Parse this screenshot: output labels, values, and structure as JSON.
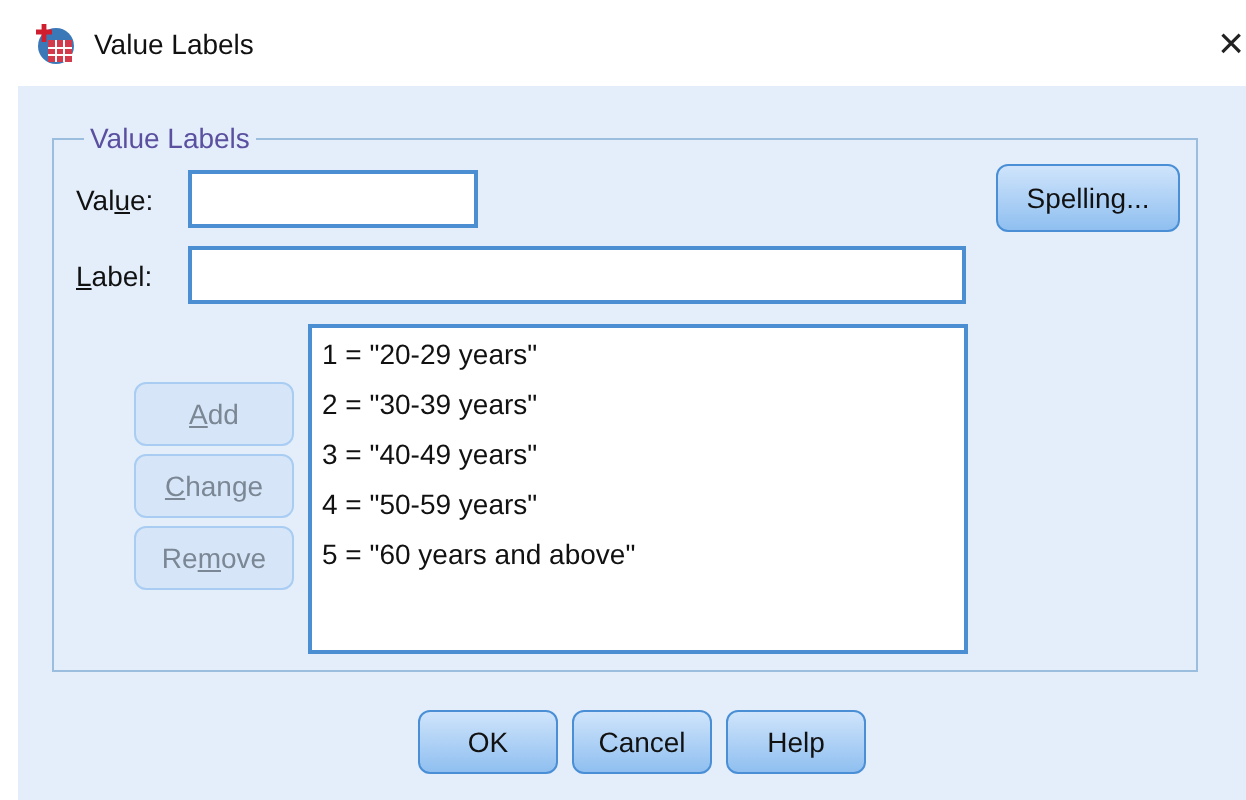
{
  "window": {
    "title": "Value Labels",
    "close": "×"
  },
  "group": {
    "legend": "Value Labels",
    "fields": [
      {
        "label": {
          "before": "Val",
          "key": "u",
          "after": "e:"
        }
      },
      {
        "label": {
          "key": "L",
          "after": "abel:"
        }
      }
    ],
    "spelling_button": "Spelling...",
    "side_buttons": [
      {
        "label": {
          "key": "A",
          "after": "dd"
        },
        "disabled": true
      },
      {
        "label": {
          "key": "C",
          "after": "hange"
        },
        "disabled": true
      },
      {
        "label": {
          "before": "Re",
          "key": "m",
          "after": "ove"
        },
        "disabled": true
      }
    ],
    "list": [
      {
        "text": "1 = \"20-29 years\"",
        "selected": false
      },
      {
        "text": "2 = \"30-39 years\"",
        "selected": false
      },
      {
        "text": "3 = \"40-49 years\"",
        "selected": false
      },
      {
        "text": "4 = \"50-59 years\"",
        "selected": false
      },
      {
        "text": "5 = \"60 years and above\"",
        "selected": false
      }
    ]
  },
  "buttons": [
    "OK",
    "Cancel",
    "Help"
  ]
}
